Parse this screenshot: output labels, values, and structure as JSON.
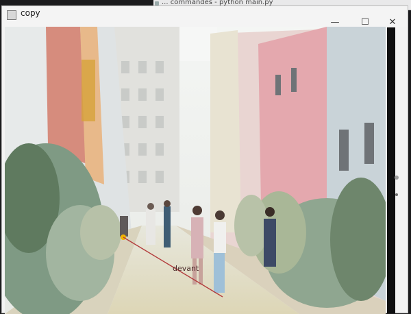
{
  "background_window": {
    "title": "... commandes - python  main.py"
  },
  "window": {
    "title": "copy"
  },
  "controls": {
    "minimize": "—",
    "maximize": "☐",
    "close": "✕"
  },
  "overlay": {
    "label": "devant",
    "tracker_point_color": "#f2b400",
    "line_color": "#b33d3d"
  }
}
